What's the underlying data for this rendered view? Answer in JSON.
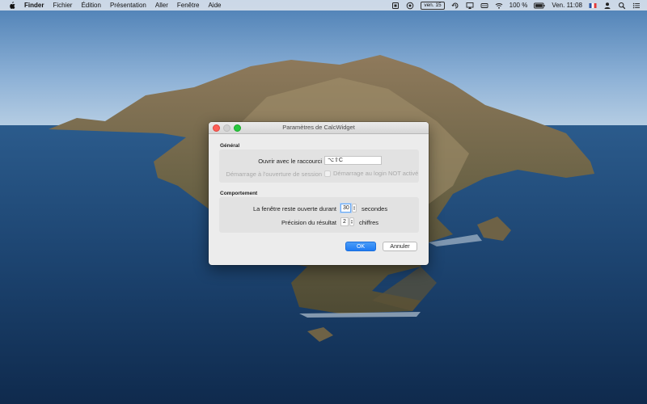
{
  "menubar": {
    "app_name": "Finder",
    "menus": [
      "Fichier",
      "Édition",
      "Présentation",
      "Aller",
      "Fenêtre",
      "Aide"
    ],
    "date_badge": "ven. 15",
    "battery": "100 %",
    "clock": "Ven. 11:08",
    "icons": [
      "apple-icon",
      "memory-icon",
      "disk-icon",
      "time-machine-icon",
      "airplay-icon",
      "battery-chip-icon",
      "wifi-icon",
      "battery-icon",
      "flag-fr-icon",
      "user-icon",
      "search-icon",
      "list-icon"
    ]
  },
  "dialog": {
    "title": "Paramètres de CalcWidget",
    "general": {
      "section": "Général",
      "shortcut_label": "Ouvrir avec le raccourci",
      "shortcut_value": "⌥⇧C",
      "startup_label": "Démarrage à l'ouverture de session",
      "startup_checkbox_label": "Démarrage au login NOT activé",
      "startup_checked": false
    },
    "behaviour": {
      "section": "Comportement",
      "duration_label": "La fenêtre reste ouverte durant",
      "duration_value": "30",
      "duration_unit": "secondes",
      "precision_label": "Précision du résultat",
      "precision_value": "2",
      "precision_unit": "chiffres"
    },
    "ok_label": "OK",
    "cancel_label": "Annuler"
  },
  "colors": {
    "accent": "#1f7bf3",
    "close": "#fe5f57",
    "maximize": "#28c840"
  }
}
